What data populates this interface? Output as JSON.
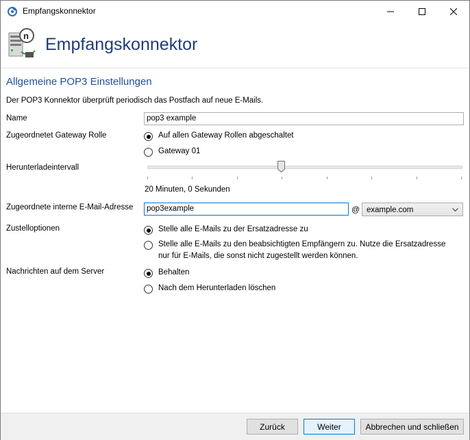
{
  "window": {
    "title": "Empfangskonnektor"
  },
  "header": {
    "title": "Empfangskonnektor",
    "logo": "server-globe-icon"
  },
  "section": {
    "title": "Allgemeine POP3 Einstellungen",
    "description": "Der POP3 Konnektor überprüft periodisch das Postfach auf neue E-Mails."
  },
  "form": {
    "name_label": "Name",
    "name_value": "pop3 example",
    "gateway_label": "Zugeordnetet Gateway Rolle",
    "gateway_options": [
      {
        "label": "Auf allen Gateway Rollen abgeschaltet",
        "selected": true
      },
      {
        "label": "Gateway 01",
        "selected": false
      }
    ],
    "interval_label": "Herunterladeintervall",
    "interval_value": "20 Minuten, 0 Sekunden",
    "interval_fraction": 0.42,
    "email_label": "Zugeordnete interne E-Mail-Adresse",
    "email_local": "pop3example",
    "email_at": "@",
    "email_domain": "example.com",
    "delivery_label": "Zustelloptionen",
    "delivery_options": [
      {
        "label": "Stelle alle E-Mails zu der Ersatzadresse zu",
        "selected": true
      },
      {
        "label": "Stelle alle E-Mails zu den beabsichtigten Empfängern zu. Nutze die Ersatzadresse",
        "label2": "nur für E-Mails, die sonst nicht zugestellt werden können.",
        "selected": false
      }
    ],
    "server_label": "Nachrichten auf dem Server",
    "server_options": [
      {
        "label": "Behalten",
        "selected": true
      },
      {
        "label": "Nach dem Herunterladen löschen",
        "selected": false
      }
    ]
  },
  "footer": {
    "back_label": "Zurück",
    "next_label": "Weiter",
    "cancel_label": "Abbrechen und schließen"
  },
  "colors": {
    "header_title": "#1f3d7a",
    "section_title": "#1f4f9c",
    "focus_border": "#0078d7"
  }
}
